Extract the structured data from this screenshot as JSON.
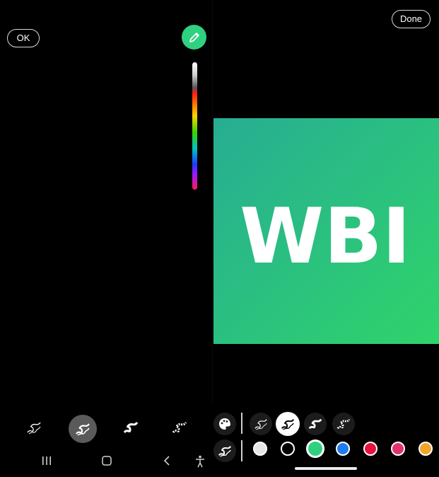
{
  "header": {
    "ok_label": "OK",
    "done_label": "Done"
  },
  "canvas": {
    "logo_text": "WBI",
    "accent": "#2fd181"
  },
  "toolbar": {
    "left_brushes": [
      "pen-brush",
      "marker-brush",
      "calligraphy-brush",
      "pixel-brush"
    ],
    "left_selected": "marker-brush",
    "right_brushes": [
      "pen-brush",
      "marker-brush",
      "calligraphy-brush",
      "pixel-brush"
    ],
    "right_selected": "marker-brush",
    "colors": [
      "#e6e6e6",
      "#000000",
      "#2fd181",
      "#1e7cf2",
      "#e8113d",
      "#e0336b",
      "#f3a52b"
    ],
    "selected_color": "#2fd181"
  },
  "navbar": {
    "icons": [
      "recent-apps-icon",
      "home-icon",
      "back-icon",
      "accessibility-icon"
    ]
  }
}
